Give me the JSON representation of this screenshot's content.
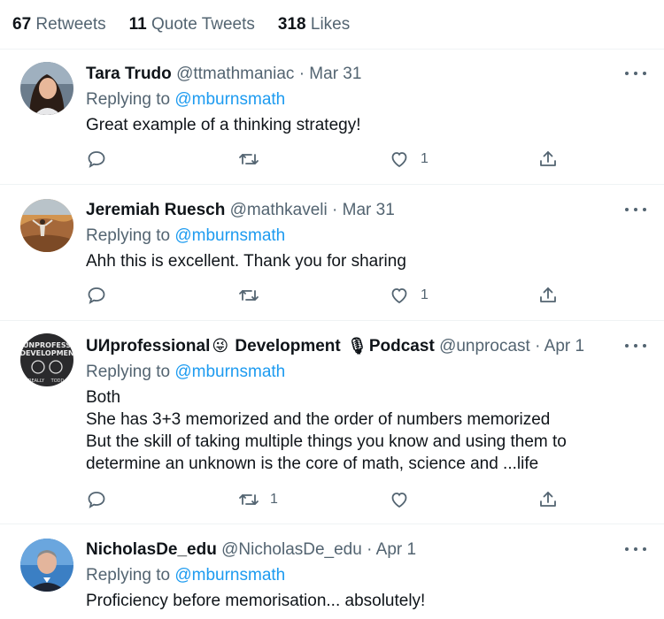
{
  "stats": {
    "retweets_count": "67",
    "retweets_label": "Retweets",
    "quotes_count": "11",
    "quotes_label": "Quote Tweets",
    "likes_count": "318",
    "likes_label": "Likes"
  },
  "tweets": [
    {
      "name": "Tara Trudo",
      "handle": "@ttmathmaniac",
      "date": "Mar 31",
      "replying_prefix": "Replying to",
      "replying_handle": "@mburnsmath",
      "text_lines": [
        "Great example of a thinking strategy!"
      ],
      "like_count": "1",
      "retweet_count": ""
    },
    {
      "name": "Jeremiah Ruesch",
      "handle": "@mathkaveli",
      "date": "Mar 31",
      "replying_prefix": "Replying to",
      "replying_handle": "@mburnsmath",
      "text_lines": [
        "Ahh this is excellent. Thank you for sharing"
      ],
      "like_count": "1",
      "retweet_count": ""
    },
    {
      "name_part1": "UИprofessional",
      "name_emoji1": "😜",
      "name_part2": "Development",
      "name_emoji2": "🎙",
      "name_part3": "Podcast",
      "avatar_text_top": "UNPROFESS",
      "avatar_text_mid": "DEVELOPMEN",
      "avatar_text_bottom_left": "REALLY",
      "avatar_text_bottom_right": "TODD",
      "handle": "@unprocast",
      "date": "Apr 1",
      "replying_prefix": "Replying to",
      "replying_handle": "@mburnsmath",
      "text_lines": [
        "Both",
        "She has 3+3 memorized and the order of numbers memorized",
        "But the skill of taking multiple things you know and using them to",
        "determine an unknown is the core of math, science and ...life"
      ],
      "like_count": "",
      "retweet_count": "1"
    },
    {
      "name": "NicholasDe_edu",
      "handle": "@NicholasDe_edu",
      "date": "Apr 1",
      "replying_prefix": "Replying to",
      "replying_handle": "@mburnsmath",
      "text_lines": [
        "Proficiency before memorisation... absolutely!"
      ]
    }
  ],
  "separator": "·",
  "colors": {
    "accent": "#1d9bf0",
    "secondary_text": "#536471",
    "divider": "#eff3f4"
  },
  "icons": [
    "reply-icon",
    "retweet-icon",
    "like-icon",
    "share-icon",
    "more-icon"
  ]
}
